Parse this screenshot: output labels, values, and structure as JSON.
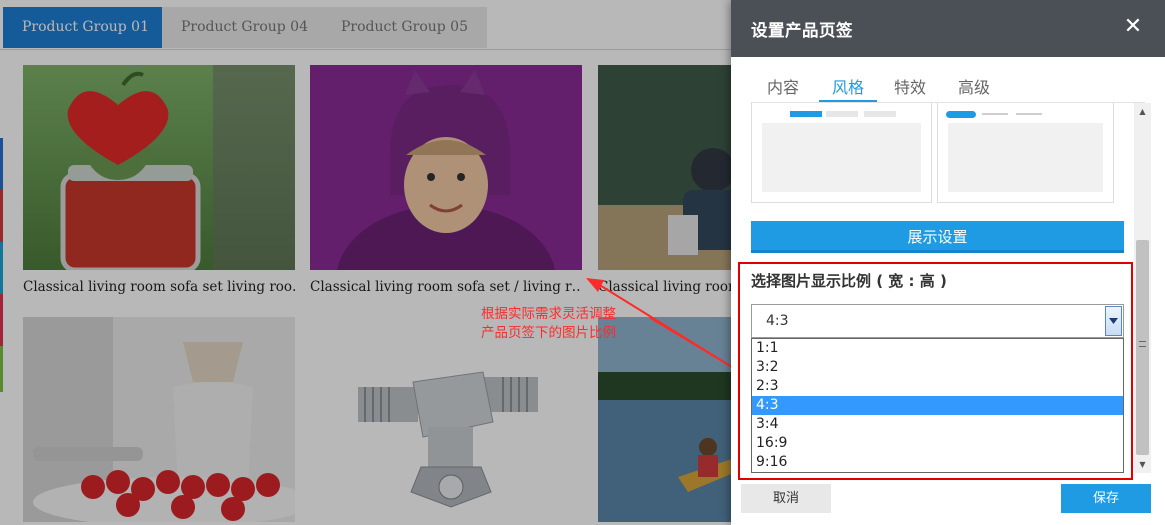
{
  "product_tabs": [
    {
      "label": "Product Group 01",
      "active": true
    },
    {
      "label": "Product Group 04",
      "active": false
    },
    {
      "label": "Product Group 05",
      "active": false
    }
  ],
  "products": [
    {
      "caption": "Classical living room sofa set living roo…",
      "image": "strawberry jar with red heart"
    },
    {
      "caption": "Classical living room sofa set / living r…",
      "image": "child in purple costume"
    },
    {
      "caption": "Classical living room sofa set living roo…",
      "image": "baseball catcher"
    },
    {
      "caption": "",
      "image": "strawberries and coffee"
    },
    {
      "caption": "",
      "image": "metal pipe tee fitting"
    },
    {
      "caption": "",
      "image": "lake with kayak"
    }
  ],
  "annotation": {
    "line1": "根据实际需求灵活调整",
    "line2": "产品页签下的图片比例",
    "color": "#ff2a2a"
  },
  "dialog": {
    "title": "设置产品页签",
    "tabs": [
      {
        "label": "内容",
        "active": false
      },
      {
        "label": "风格",
        "active": true
      },
      {
        "label": "特效",
        "active": false
      },
      {
        "label": "高级",
        "active": false
      }
    ],
    "show_settings_label": "展示设置",
    "ratio_label": "选择图片显示比例 ( 宽 : 高 )",
    "ratio_selected": "4:3",
    "ratio_options": [
      "1:1",
      "3:2",
      "2:3",
      "4:3",
      "3:4",
      "16:9",
      "9:16"
    ],
    "cancel_label": "取消",
    "save_label": "保存"
  },
  "colors": {
    "accent": "#1e9be2",
    "tab_active": "#1f7fd4",
    "header": "#4b5057",
    "highlight_box": "#e00000"
  }
}
